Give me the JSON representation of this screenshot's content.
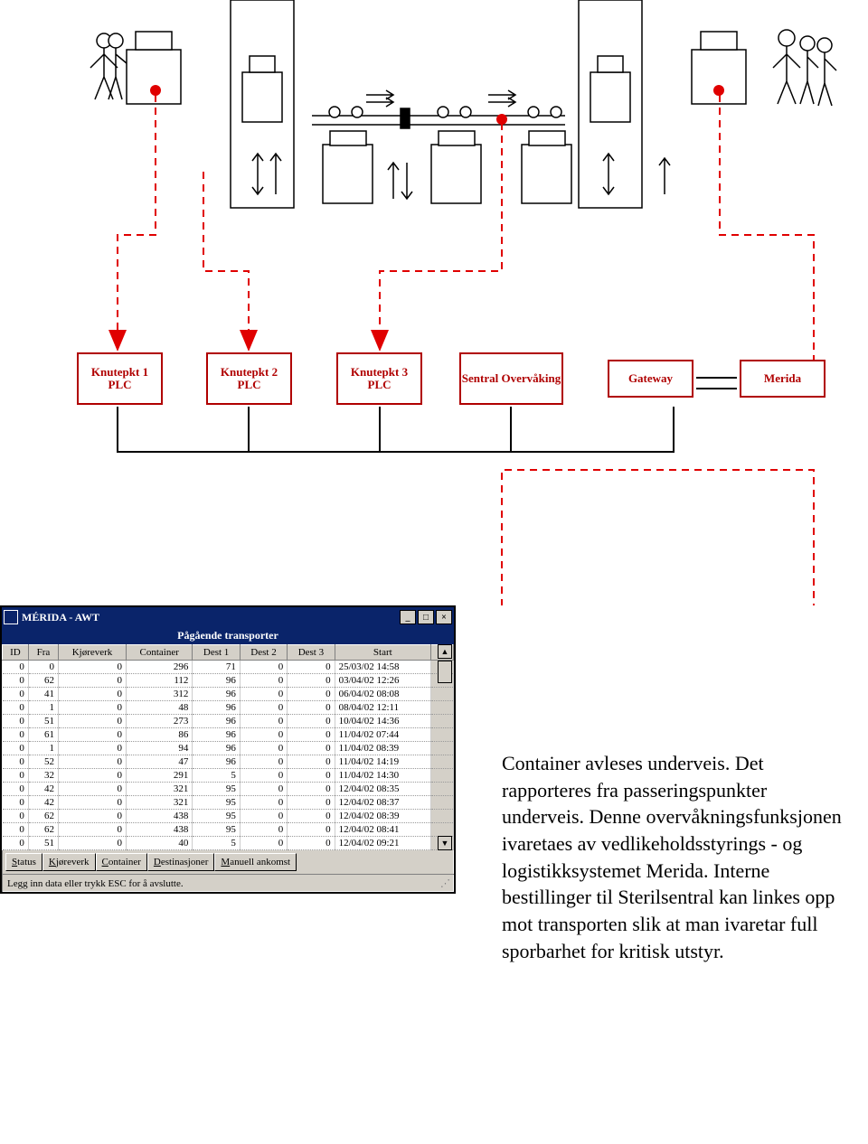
{
  "nodes": [
    {
      "label": "Knutepkt\n1\nPLC"
    },
    {
      "label": "Knutepkt\n2\nPLC"
    },
    {
      "label": "Knutepkt\n3\nPLC"
    },
    {
      "label": "Sentral\nOvervåking"
    },
    {
      "label": "Gateway"
    },
    {
      "label": "Merida"
    }
  ],
  "window": {
    "title": "MÉRIDA - AWT",
    "subtitle": "Pågående transporter",
    "columns": [
      "ID",
      "Fra",
      "Kjøreverk",
      "Container",
      "Dest 1",
      "Dest 2",
      "Dest 3",
      "Start"
    ],
    "rows": [
      [
        "0",
        "0",
        "0",
        "296",
        "71",
        "0",
        "0",
        "25/03/02 14:58"
      ],
      [
        "0",
        "62",
        "0",
        "112",
        "96",
        "0",
        "0",
        "03/04/02 12:26"
      ],
      [
        "0",
        "41",
        "0",
        "312",
        "96",
        "0",
        "0",
        "06/04/02 08:08"
      ],
      [
        "0",
        "1",
        "0",
        "48",
        "96",
        "0",
        "0",
        "08/04/02 12:11"
      ],
      [
        "0",
        "51",
        "0",
        "273",
        "96",
        "0",
        "0",
        "10/04/02 14:36"
      ],
      [
        "0",
        "61",
        "0",
        "86",
        "96",
        "0",
        "0",
        "11/04/02 07:44"
      ],
      [
        "0",
        "1",
        "0",
        "94",
        "96",
        "0",
        "0",
        "11/04/02 08:39"
      ],
      [
        "0",
        "52",
        "0",
        "47",
        "96",
        "0",
        "0",
        "11/04/02 14:19"
      ],
      [
        "0",
        "32",
        "0",
        "291",
        "5",
        "0",
        "0",
        "11/04/02 14:30"
      ],
      [
        "0",
        "42",
        "0",
        "321",
        "95",
        "0",
        "0",
        "12/04/02 08:35"
      ],
      [
        "0",
        "42",
        "0",
        "321",
        "95",
        "0",
        "0",
        "12/04/02 08:37"
      ],
      [
        "0",
        "62",
        "0",
        "438",
        "95",
        "0",
        "0",
        "12/04/02 08:39"
      ],
      [
        "0",
        "62",
        "0",
        "438",
        "95",
        "0",
        "0",
        "12/04/02 08:41"
      ],
      [
        "0",
        "51",
        "0",
        "40",
        "5",
        "0",
        "0",
        "12/04/02 09:21"
      ]
    ],
    "buttons": [
      "Status",
      "Kjøreverk",
      "Container",
      "Destinasjoner",
      "Manuell ankomst"
    ],
    "status": "Legg inn data eller trykk ESC for å avslutte."
  },
  "paragraph": "Container avleses underveis. Det rapporteres fra passeringspunkter underveis. Denne overvåkningsfunksjonen ivaretaes av vedlikeholdsstyrings - og logistikksystemet Merida. Interne bestillinger til Sterilsentral kan linkes opp mot transporten slik at man ivaretar full sporbarhet for kritisk utstyr."
}
